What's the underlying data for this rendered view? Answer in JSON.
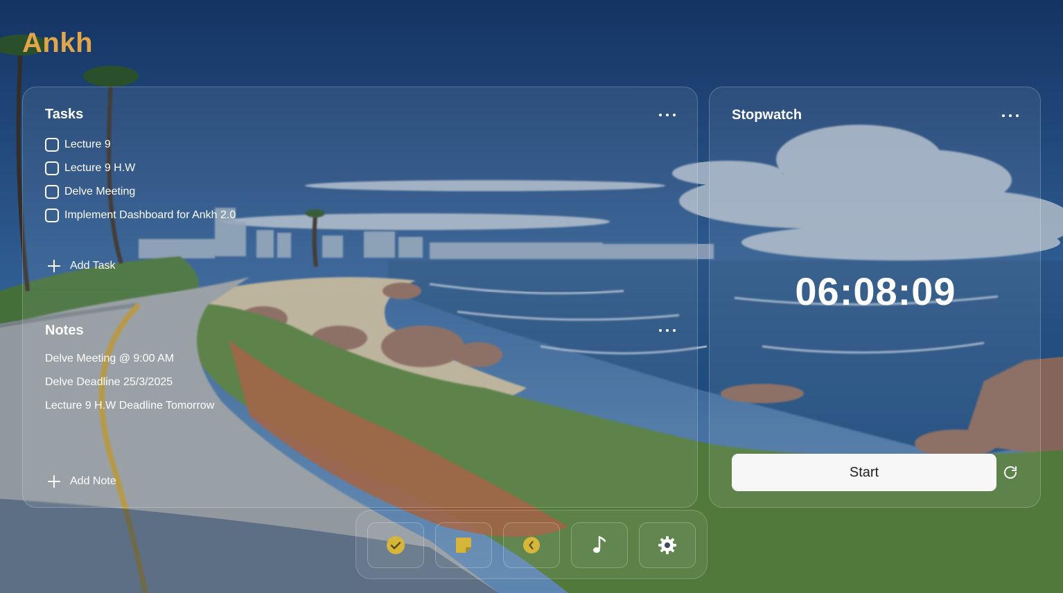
{
  "app": {
    "logo": "Ankh"
  },
  "colors": {
    "accent": "#e2a64a",
    "icon_yellow": "#d6b63a",
    "panel_border": "#ffffffaa"
  },
  "tasks": {
    "title": "Tasks",
    "items": [
      {
        "label": "Lecture 9",
        "done": false
      },
      {
        "label": "Lecture 9 H.W",
        "done": false
      },
      {
        "label": "Delve Meeting",
        "done": false
      },
      {
        "label": "Implement Dashboard for Ankh 2.0",
        "done": false
      }
    ],
    "add_label": "Add Task"
  },
  "notes": {
    "title": "Notes",
    "items": [
      "Delve Meeting @ 9:00 AM",
      "Delve Deadline 25/3/2025",
      "Lecture 9 H.W Deadline Tomorrow"
    ],
    "add_label": "Add Note"
  },
  "stopwatch": {
    "title": "Stopwatch",
    "time": "06:08:09",
    "start_label": "Start"
  },
  "dock": [
    {
      "name": "tasks",
      "icon": "check-circle-icon"
    },
    {
      "name": "notes",
      "icon": "sticky-note-icon"
    },
    {
      "name": "stopwatch",
      "icon": "clock-icon"
    },
    {
      "name": "music",
      "icon": "music-note-icon"
    },
    {
      "name": "settings",
      "icon": "gear-icon"
    }
  ]
}
